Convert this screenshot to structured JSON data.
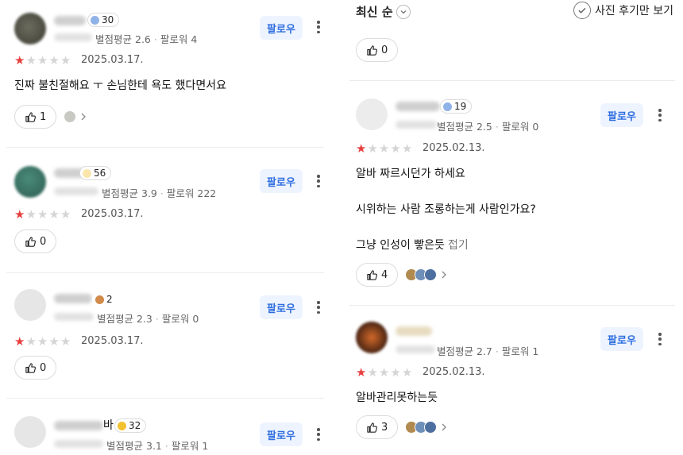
{
  "follow_label": "팔로우",
  "meta_rating_label": "별점평균",
  "meta_follower_label": "팔로워",
  "sort": {
    "label": "최신 순"
  },
  "photo_only": {
    "label": "사진 후기만 보기"
  },
  "left_reviews": [
    {
      "level": "30",
      "rating_avg": "2.6",
      "followers": "4",
      "date": "2025.03.17.",
      "text": [
        "진짜 불친절해요 ㅜ 손님한테 욕도 했다면서요"
      ],
      "likes": "1",
      "stars": 1
    },
    {
      "level": "56",
      "rating_avg": "3.9",
      "followers": "222",
      "date": "2025.03.17.",
      "text": [],
      "likes": "0",
      "stars": 1
    },
    {
      "level": "2",
      "rating_avg": "2.3",
      "followers": "0",
      "date": "2025.03.17.",
      "text": [],
      "likes": "0",
      "stars": 1
    },
    {
      "level": "32",
      "name_suffix": "바",
      "rating_avg": "3.1",
      "followers": "1"
    }
  ],
  "top_partial": {
    "likes": "0"
  },
  "right_reviews": [
    {
      "level": "19",
      "rating_avg": "2.5",
      "followers": "0",
      "date": "2025.02.13.",
      "text": [
        "알바 짜르시던가 하세요",
        "시위하는 사람 조롱하는게 사람인가요?",
        "그냥 인성이 빻은듯"
      ],
      "fold": "접기",
      "likes": "4",
      "stars": 1
    },
    {
      "rating_avg": "2.7",
      "followers": "1",
      "date": "2025.02.13.",
      "text": [
        "알바관리못하는듯"
      ],
      "likes": "3",
      "stars": 1
    }
  ],
  "colors": {
    "accent": "#2f6ee0",
    "star_on": "#e83f3f",
    "star_off": "#d5d5d5"
  }
}
